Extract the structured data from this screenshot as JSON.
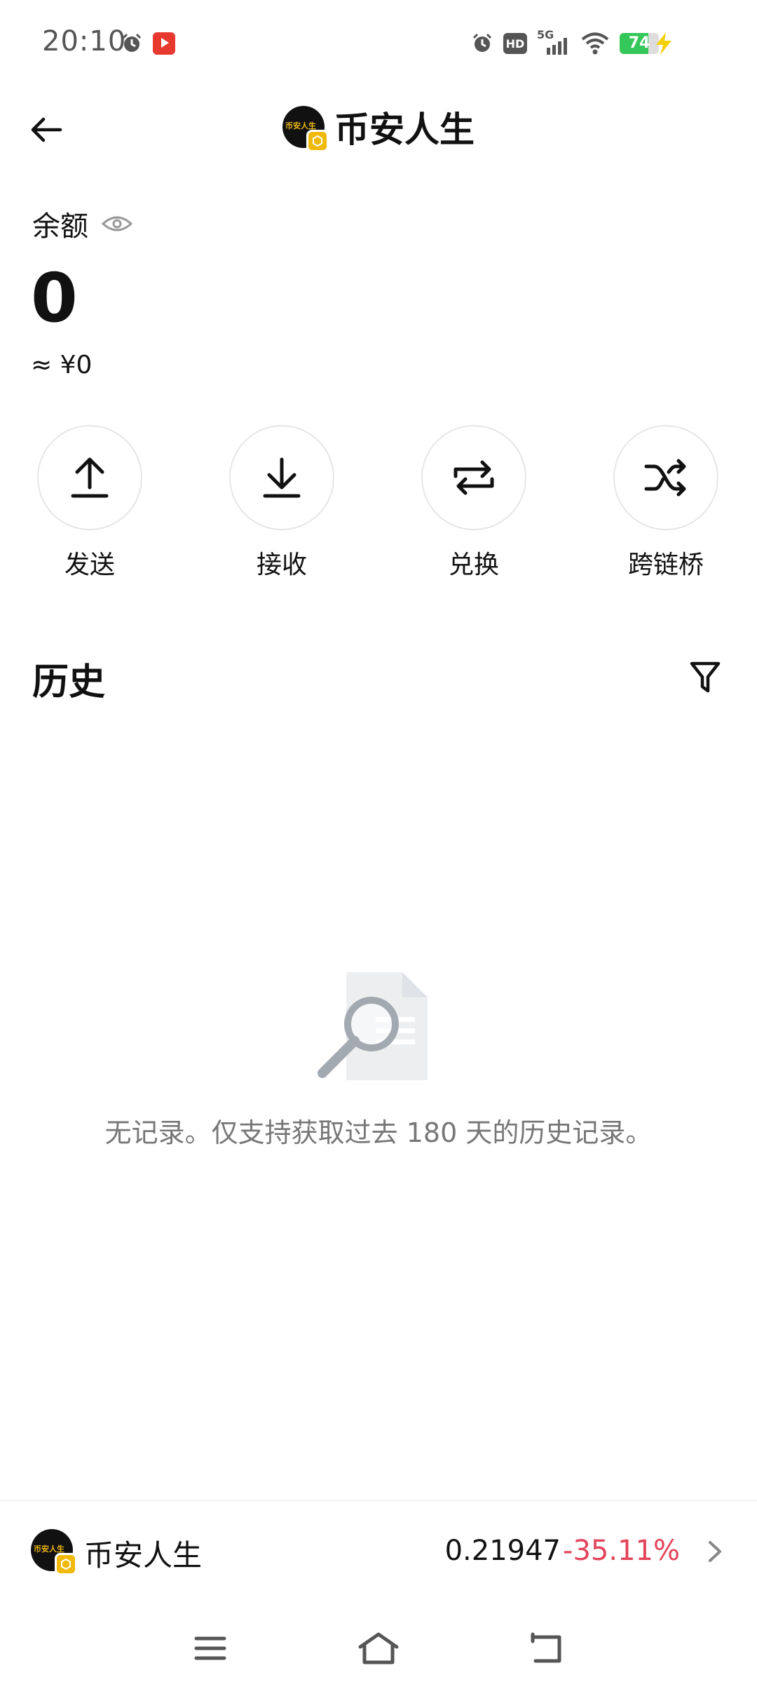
{
  "status_bar": {
    "time": "20:10",
    "hd_label": "HD",
    "network_label": "5G",
    "battery_level": 74,
    "battery_text": "74",
    "icons": [
      "alarm-icon",
      "video-app-icon",
      "alarm-icon",
      "hd-icon",
      "signal-icon",
      "wifi-icon",
      "battery-icon",
      "charging-icon"
    ]
  },
  "header": {
    "title": "币安人生",
    "back_icon": "arrow-left-icon",
    "avatar_text": "币安人生"
  },
  "balance": {
    "label": "余额",
    "value": "0",
    "fiat": "≈ ¥0"
  },
  "actions": [
    {
      "label": "发送",
      "icon": "upload-icon"
    },
    {
      "label": "接收",
      "icon": "download-icon"
    },
    {
      "label": "兑换",
      "icon": "swap-icon"
    },
    {
      "label": "跨链桥",
      "icon": "shuffle-icon"
    }
  ],
  "history": {
    "title": "历史",
    "empty_text": "无记录。仅支持获取过去 180 天的历史记录。"
  },
  "ticker": {
    "name": "币安人生",
    "price": "0.21947",
    "change": "-35.11%",
    "change_color": "#e3445a"
  },
  "colors": {
    "brand": "#f0b90b",
    "negative": "#e3445a",
    "battery": "#34c759"
  }
}
